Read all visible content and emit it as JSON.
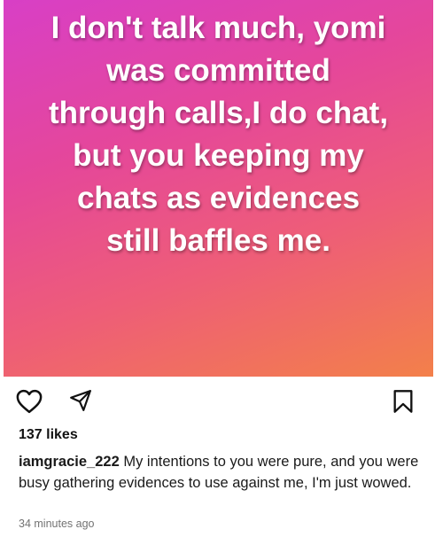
{
  "post": {
    "image_text": "I don't talk much, yomi\nwas committed\nthrough calls,I do chat,\nbut you keeping my\nchats as evidences\nstill baffles me."
  },
  "actions": {
    "like_icon": "heart-icon",
    "share_icon": "send-icon",
    "save_icon": "bookmark-icon"
  },
  "likes": "137 likes",
  "caption": {
    "username": "iamgracie_222",
    "text": " My intentions to you were pure, and you were busy gathering evidences to use against me, I'm just wowed."
  },
  "timestamp": "34 minutes ago"
}
